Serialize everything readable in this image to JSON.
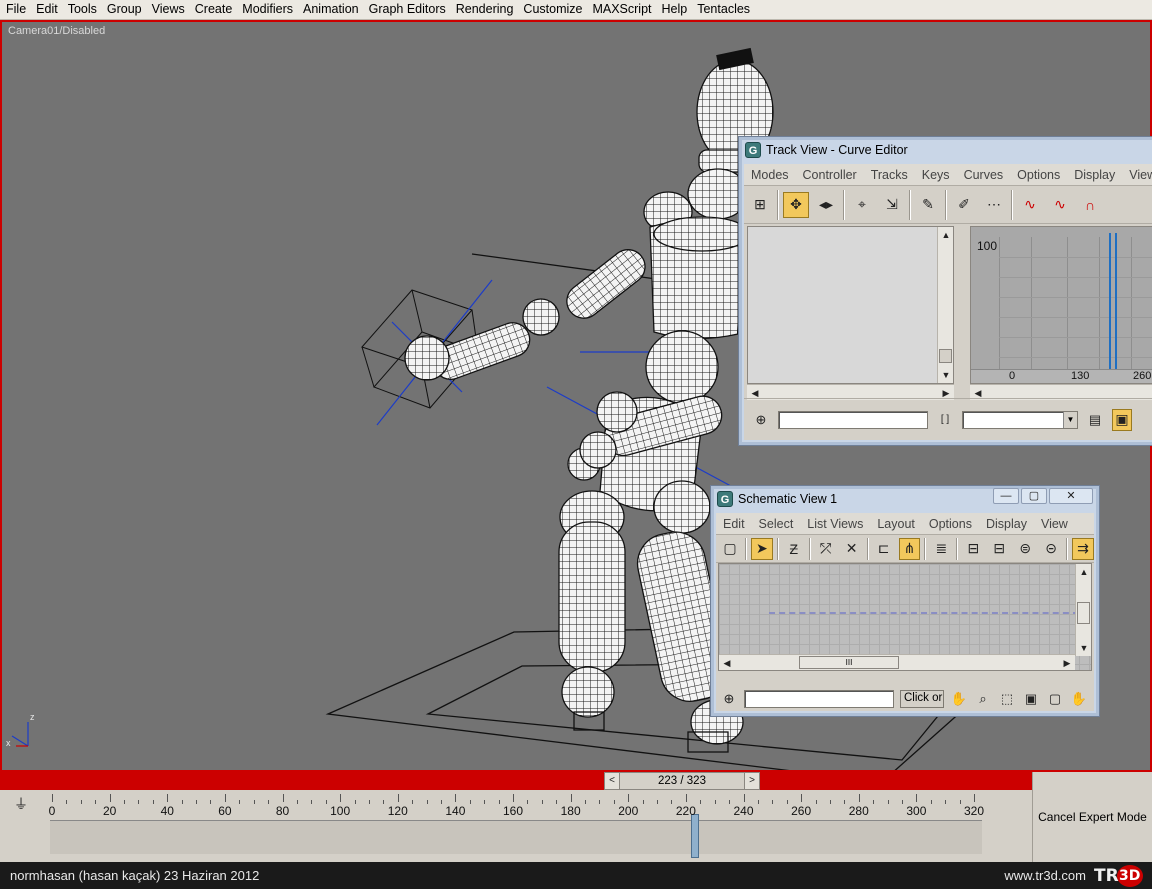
{
  "menubar": {
    "items": [
      "File",
      "Edit",
      "Tools",
      "Group",
      "Views",
      "Create",
      "Modifiers",
      "Animation",
      "Graph Editors",
      "Rendering",
      "Customize",
      "MAXScript",
      "Help",
      "Tentacles"
    ]
  },
  "viewport": {
    "label": "Camera01/Disabled",
    "axis_z": "z",
    "axis_x": "x"
  },
  "track_view": {
    "title": "Track View - Curve Editor",
    "menu": [
      "Modes",
      "Controller",
      "Tracks",
      "Keys",
      "Curves",
      "Options",
      "Display",
      "View"
    ],
    "graph_value_label": "100",
    "ruler_labels": [
      "0",
      "130",
      "260"
    ],
    "colors": {
      "curve_marker": "#1f6fc2"
    }
  },
  "schematic_view": {
    "title": "Schematic View 1",
    "menu": [
      "Edit",
      "Select",
      "List Views",
      "Layout",
      "Options",
      "Display",
      "View"
    ],
    "prompt_text": "Click or",
    "scroll_thumb": "III"
  },
  "time_slider": {
    "frame_text": "223 / 323",
    "prev": "<",
    "next": ">",
    "current_frame": 223,
    "total_frames": 323
  },
  "track_bar": {
    "tick_labels": [
      "0",
      "20",
      "40",
      "60",
      "80",
      "100",
      "120",
      "140",
      "160",
      "180",
      "200",
      "220",
      "240",
      "260",
      "280",
      "300",
      "320"
    ]
  },
  "expert_mode": {
    "cancel_label": "Cancel Expert Mode"
  },
  "statusbar": {
    "left_text": "normhasan (hasan kaçak)  23 Haziran 2012",
    "right_text": "www.tr3d.com",
    "logo_tr": "TR",
    "logo_3d": "3D"
  },
  "colors": {
    "viewport_bg": "#737373",
    "viewport_border": "#cc0000",
    "active_tool": "#f2c85c"
  }
}
